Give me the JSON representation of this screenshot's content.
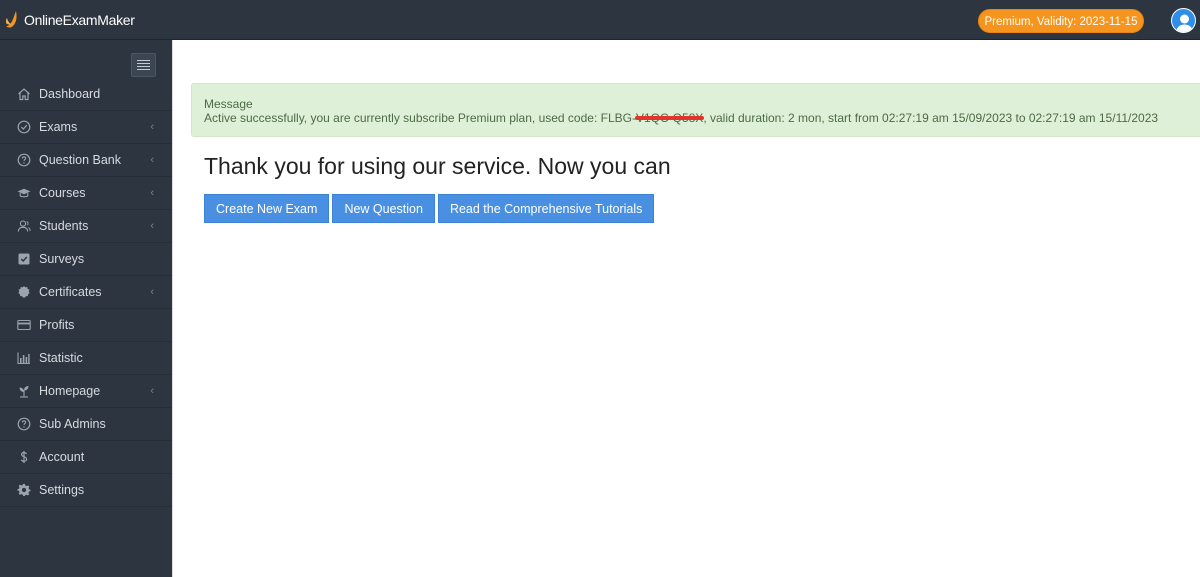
{
  "header": {
    "logo_text": "OnlineExamMaker",
    "premium_badge": "Premium, Validity: 2023-11-15",
    "colors": {
      "topbar": "#2c3540",
      "badge": "#f5941e",
      "avatar": "#2f8fe8"
    }
  },
  "sidebar": {
    "items": [
      {
        "label": "Dashboard",
        "icon": "home-icon",
        "has_submenu": false
      },
      {
        "label": "Exams",
        "icon": "check-circle-icon",
        "has_submenu": true
      },
      {
        "label": "Question Bank",
        "icon": "question-circle-icon",
        "has_submenu": true
      },
      {
        "label": "Courses",
        "icon": "graduation-cap-icon",
        "has_submenu": true
      },
      {
        "label": "Students",
        "icon": "users-icon",
        "has_submenu": true
      },
      {
        "label": "Surveys",
        "icon": "check-square-icon",
        "has_submenu": false
      },
      {
        "label": "Certificates",
        "icon": "certificate-icon",
        "has_submenu": true
      },
      {
        "label": "Profits",
        "icon": "credit-card-icon",
        "has_submenu": false
      },
      {
        "label": "Statistic",
        "icon": "bar-chart-icon",
        "has_submenu": false
      },
      {
        "label": "Homepage",
        "icon": "leaf-icon",
        "has_submenu": true
      },
      {
        "label": "Sub Admins",
        "icon": "question-circle-icon",
        "has_submenu": false
      },
      {
        "label": "Account",
        "icon": "dollar-icon",
        "has_submenu": false
      },
      {
        "label": "Settings",
        "icon": "gear-icon",
        "has_submenu": false
      }
    ],
    "chevron_glyph": "‹"
  },
  "alert": {
    "title": "Message",
    "text_before_code": "Active successfully, you are currently subscribe Premium plan, used code: FLBG-",
    "code_redacted": "V1QC-Q58X",
    "text_after_code": ", valid duration: 2 mon, start from 02:27:19 am 15/09/2023 to 02:27:19 am 15/11/2023"
  },
  "main": {
    "headline": "Thank you for using our service. Now you can",
    "buttons": [
      {
        "label": "Create New Exam"
      },
      {
        "label": "New Question"
      },
      {
        "label": "Read the Comprehensive Tutorials"
      }
    ]
  }
}
